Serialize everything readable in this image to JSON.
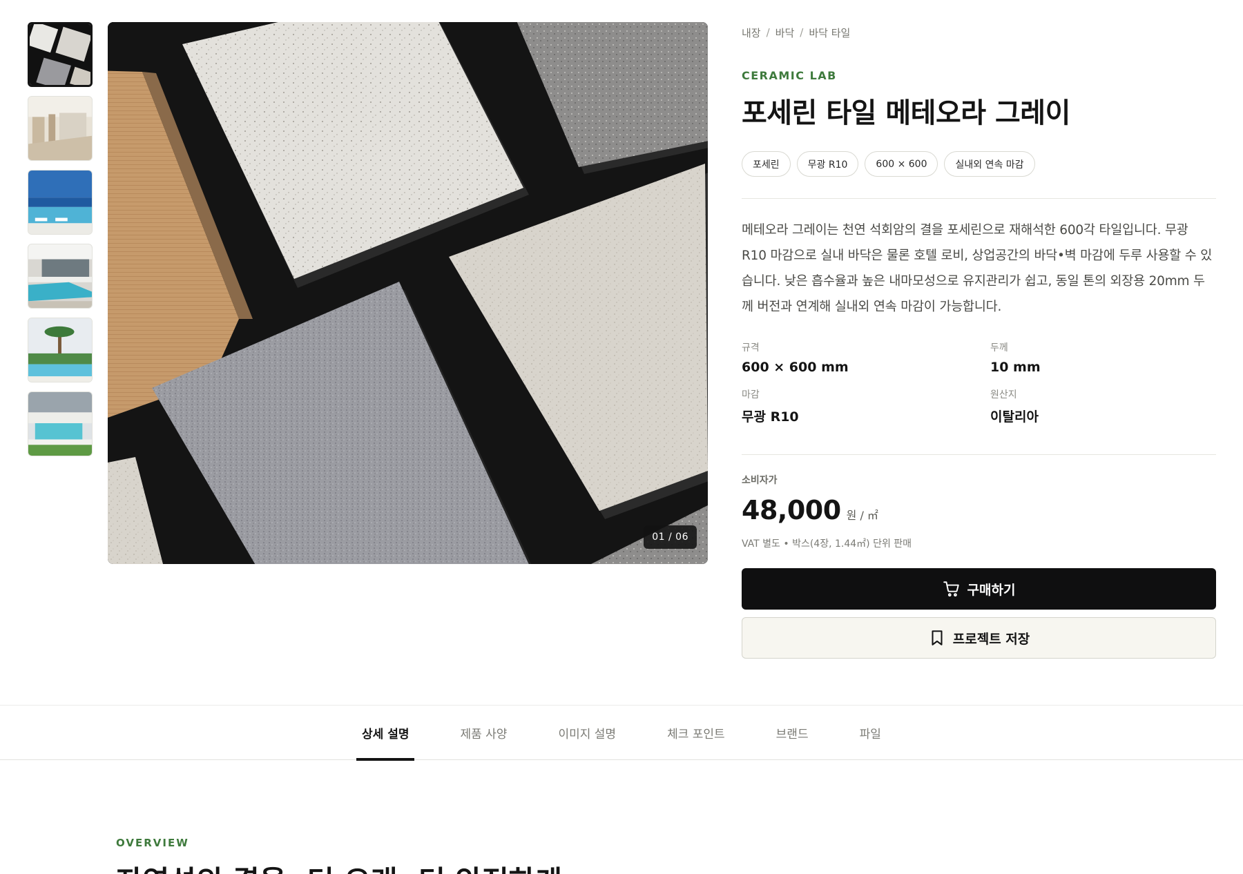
{
  "gallery": {
    "thumbnails": [
      {
        "icon": "tile-samples-thumbnail"
      },
      {
        "icon": "hotel-lobby-thumbnail"
      },
      {
        "icon": "seaside-pool-thumbnail"
      },
      {
        "icon": "villa-pool-thumbnail"
      },
      {
        "icon": "palm-pool-thumbnail"
      },
      {
        "icon": "garden-pool-thumbnail"
      }
    ],
    "active_index": 0,
    "counter": "01 / 06"
  },
  "breadcrumb": [
    "내장",
    "바닥",
    "바닥 타일"
  ],
  "product": {
    "brand": "CERAMIC LAB",
    "title": "포세린 타일 메테오라 그레이",
    "chips": [
      "포세린",
      "무광 R10",
      "600 × 600",
      "실내외 연속 마감"
    ],
    "description": "메테오라 그레이는 천연 석회암의 결을 포세린으로 재해석한 600각 타일입니다. 무광 R10 마감으로 실내 바닥은 물론 호텔 로비, 상업공간의 바닥•벽 마감에 두루 사용할 수 있습니다. 낮은 흡수율과 높은 내마모성으로 유지관리가 쉽고, 동일 톤의 외장용 20mm 두께 버전과 연계해 실내외 연속 마감이 가능합니다.",
    "specs": [
      {
        "label": "규격",
        "value": "600 × 600 mm"
      },
      {
        "label": "두께",
        "value": "10 mm"
      },
      {
        "label": "마감",
        "value": "무광 R10"
      },
      {
        "label": "원산지",
        "value": "이탈리아"
      }
    ],
    "price_label": "소비자가",
    "price": "48,000",
    "price_unit": "원 / ㎡",
    "vat_note": "VAT 별도 • 박스(4장, 1.44㎡) 단위 판매",
    "buy_label": "구매하기",
    "save_label": "프로젝트 저장"
  },
  "tabs": [
    "상세 설명",
    "제품 사양",
    "이미지 설명",
    "체크 포인트",
    "브랜드",
    "파일"
  ],
  "active_tab": 0,
  "overview": {
    "label": "OVERVIEW",
    "heading": "자연석의 결을, 더 오래, 더 안전하게"
  },
  "colors": {
    "accent_green": "#3e7a3c",
    "primary_button": "#0f0f10",
    "secondary_button": "#f7f6f0"
  }
}
